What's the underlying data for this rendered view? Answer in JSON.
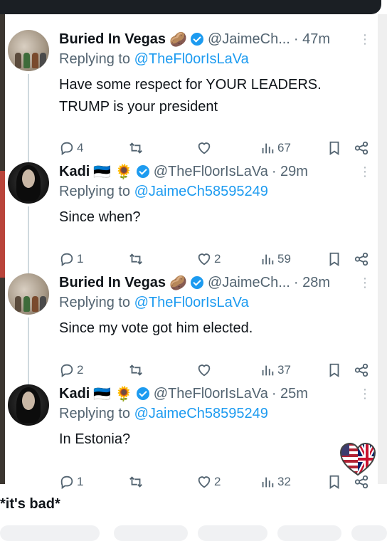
{
  "tweets": [
    {
      "name": "Buried In Vegas",
      "emoji": "🥔",
      "handle": "@JaimeCh...",
      "time": "· 47m",
      "replying_prefix": "Replying to ",
      "replying_to": "@TheFl0orIsLaVa",
      "text": "Have some respect for YOUR LEADERS.\nTRUMP is your president",
      "replies": "4",
      "retweets": "",
      "likes": "",
      "views": "67"
    },
    {
      "name": "Kadi",
      "emoji": "🇪🇪 🌻",
      "handle": "@TheFl0orIsLaVa",
      "time": "· 29m",
      "replying_prefix": "Replying to ",
      "replying_to": "@JaimeCh58595249",
      "text": "Since when?",
      "replies": "1",
      "retweets": "",
      "likes": "2",
      "views": "59"
    },
    {
      "name": "Buried In Vegas",
      "emoji": "🥔",
      "handle": "@JaimeCh...",
      "time": "· 28m",
      "replying_prefix": "Replying to ",
      "replying_to": "@TheFl0orIsLaVa",
      "text": "Since my vote got him elected.",
      "replies": "2",
      "retweets": "",
      "likes": "",
      "views": "37"
    },
    {
      "name": "Kadi",
      "emoji": "🇪🇪 🌻",
      "handle": "@TheFl0orIsLaVa",
      "time": "· 25m",
      "replying_prefix": "Replying to ",
      "replying_to": "@JaimeCh58595249",
      "text": "In Estonia?",
      "replies": "1",
      "retweets": "",
      "likes": "2",
      "views": "32"
    }
  ],
  "caption": "*it's bad*",
  "colors": {
    "link": "#1d9bf0",
    "muted": "#536471",
    "verified": "#1d9bf0"
  }
}
